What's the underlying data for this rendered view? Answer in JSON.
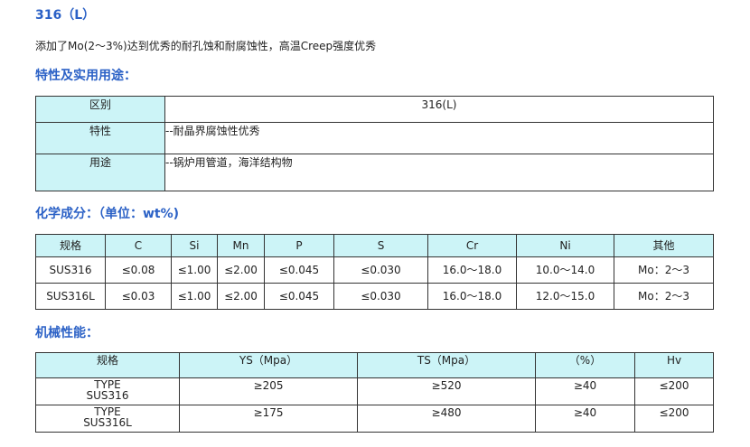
{
  "title": "316（L）",
  "intro": "添加了Mo(2～3%)达到优秀的耐孔蚀和耐腐蚀性，高温Creep强度优秀",
  "sections": {
    "properties": "特性及实用用途：",
    "chemical": "化学成分：（单位：wt%)",
    "mechanical": "机械性能："
  },
  "properties_table": {
    "rows": [
      {
        "label": "区别",
        "value": "316(L)"
      },
      {
        "label": "特性",
        "value": "--耐晶界腐蚀性优秀"
      },
      {
        "label": "用途",
        "value": "--锅炉用管道，海洋结构物"
      }
    ]
  },
  "chemical_table": {
    "headers": [
      "规格",
      "C",
      "Si",
      "Mn",
      "P",
      "S",
      "Cr",
      "Ni",
      "其他"
    ],
    "rows": [
      [
        "SUS316",
        "≤0.08",
        "≤1.00",
        "≤2.00",
        "≤0.045",
        "≤0.030",
        "16.0～18.0",
        "10.0～14.0",
        "Mo：2～3"
      ],
      [
        "SUS316L",
        "≤0.03",
        "≤1.00",
        "≤2.00",
        "≤0.045",
        "≤0.030",
        "16.0～18.0",
        "12.0～15.0",
        "Mo：2～3"
      ]
    ]
  },
  "mechanical_table": {
    "headers": [
      "规格",
      "YS（Mpa）",
      "TS（Mpa）",
      "（%）",
      "Hv"
    ],
    "rows": [
      {
        "type_line1": "TYPE",
        "type_line2": "SUS316",
        "ys": "≥205",
        "ts": "≥520",
        "pct": "≥40",
        "hv": "≤200"
      },
      {
        "type_line1": "TYPE",
        "type_line2": "SUS316L",
        "ys": "≥175",
        "ts": "≥480",
        "pct": "≥40",
        "hv": "≤200"
      }
    ]
  }
}
